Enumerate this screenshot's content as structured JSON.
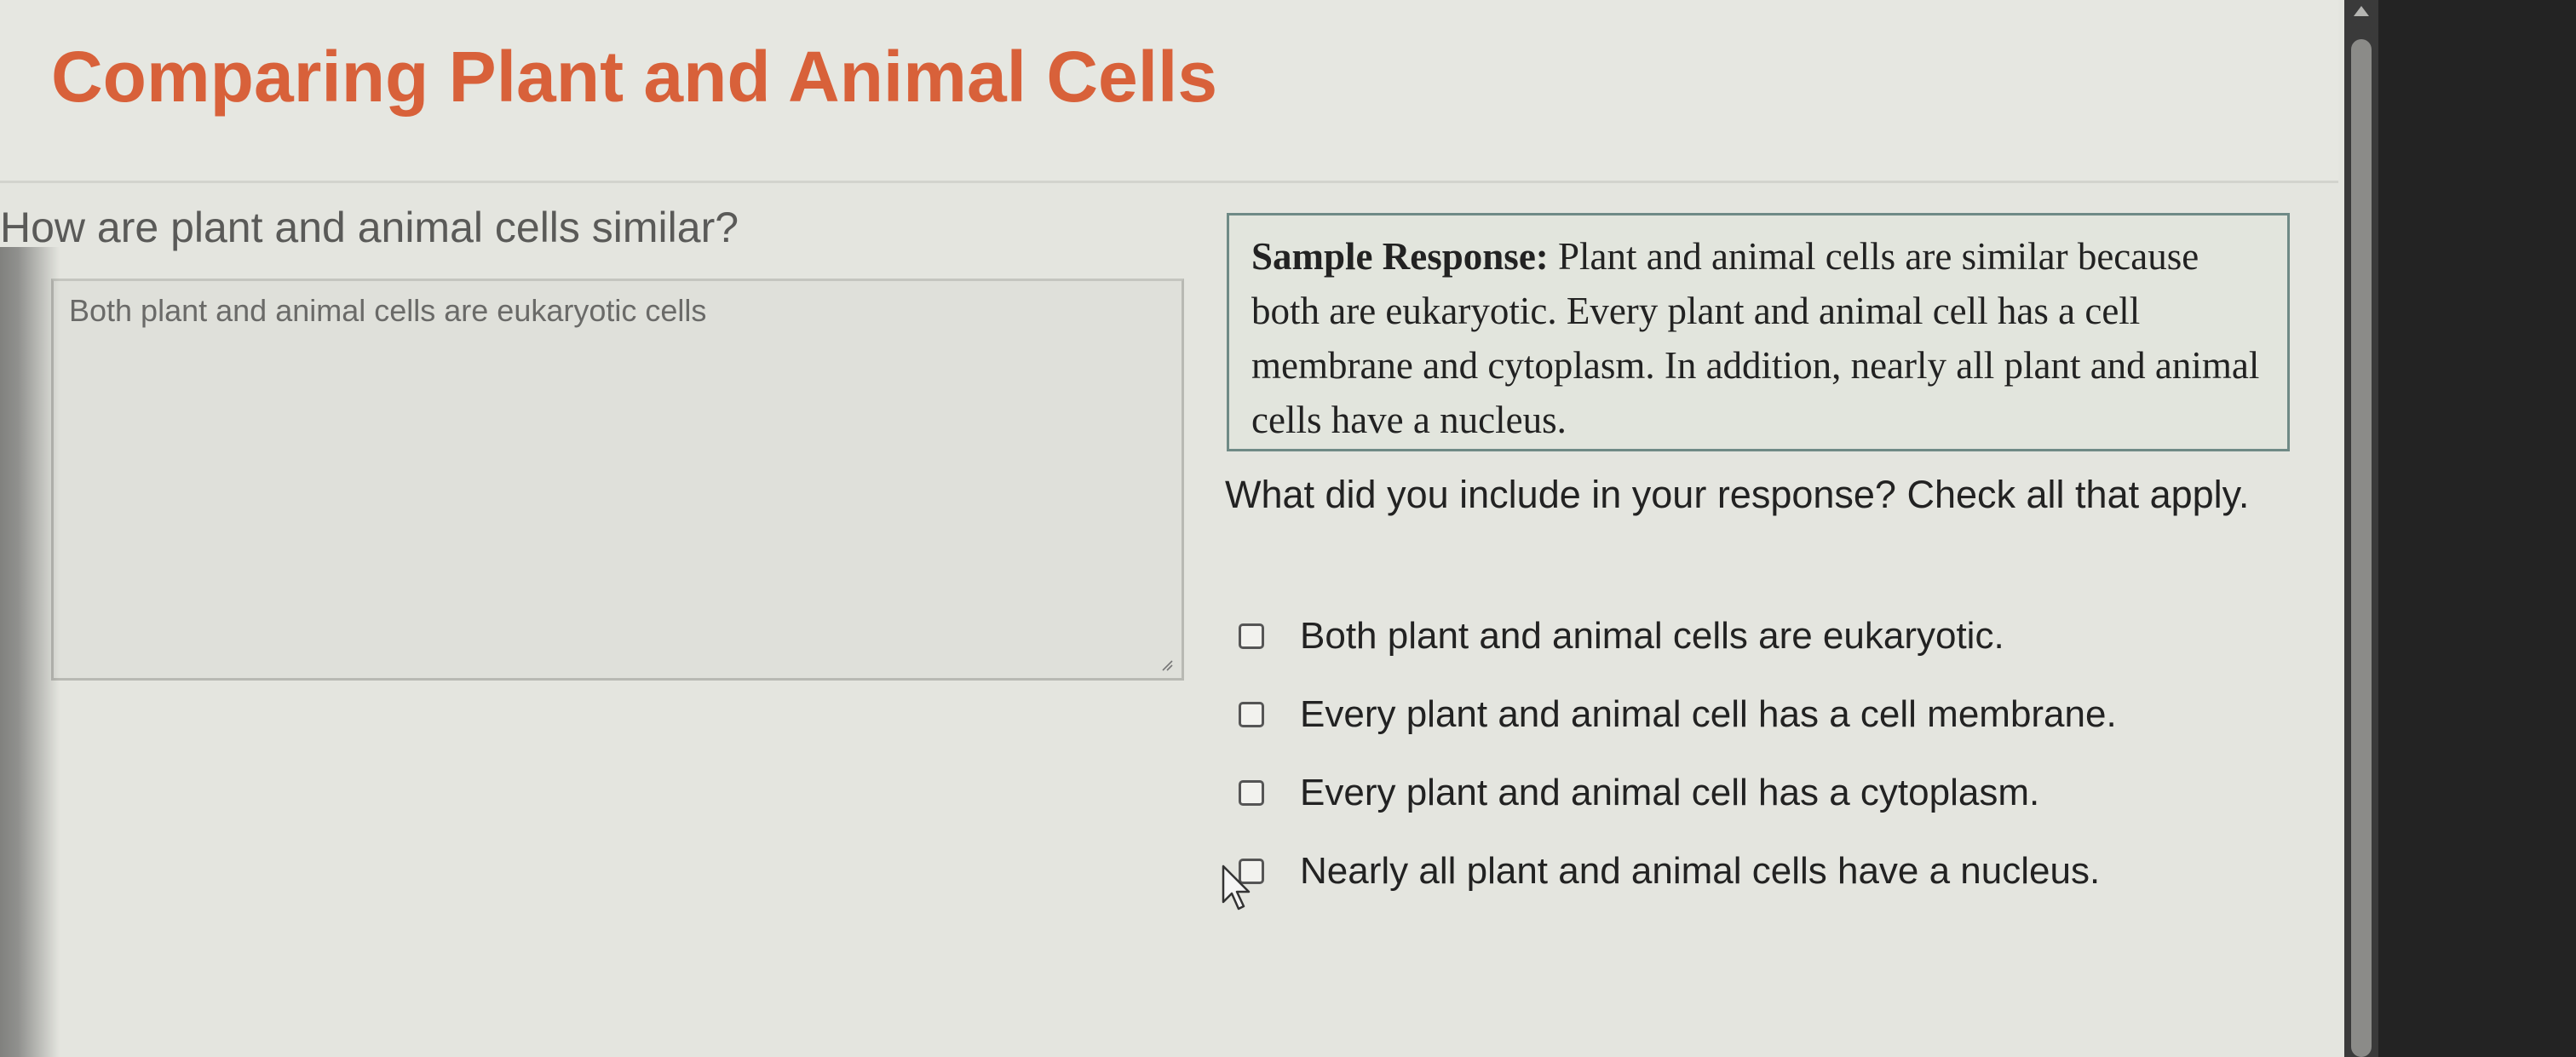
{
  "header": {
    "title": "Comparing Plant and Animal Cells"
  },
  "question": {
    "text": "How are plant and animal cells similar?"
  },
  "answer": {
    "text": "Both plant and animal cells are eukaryotic cells"
  },
  "sample": {
    "label": "Sample Response:",
    "text": "Plant and animal cells are similar because both are eukaryotic. Every plant and animal cell has a cell membrane and cytoplasm. In addition, nearly all plant and animal cells have a nucleus."
  },
  "prompt": {
    "text": "What did you include in your response? Check all that apply."
  },
  "options": [
    {
      "label": "Both plant and animal cells are eukaryotic.",
      "checked": false
    },
    {
      "label": "Every plant and animal cell has a cell membrane.",
      "checked": false
    },
    {
      "label": "Every plant and animal cell has a cytoplasm.",
      "checked": false
    },
    {
      "label": "Nearly all plant and animal cells have a nucleus.",
      "checked": false
    }
  ],
  "colors": {
    "title": "#d8613a",
    "sample_border": "#6f8a86"
  },
  "icons": {
    "resize": "resize-handle-icon",
    "cursor": "mouse-pointer-icon",
    "scroll_up": "arrow-up-icon"
  }
}
